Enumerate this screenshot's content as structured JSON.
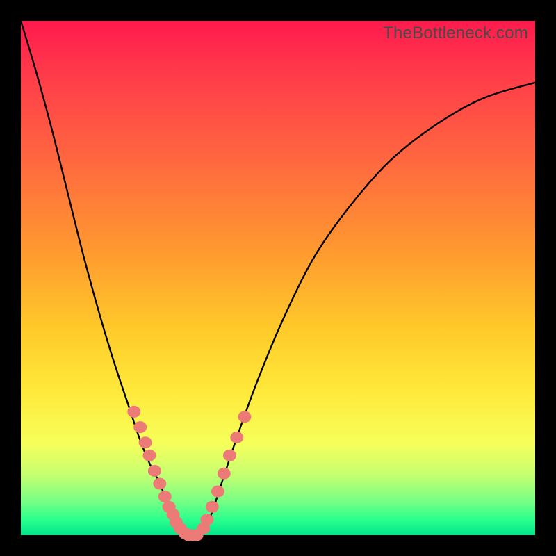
{
  "watermark": "TheBottleneck.com",
  "colors": {
    "frame": "#000000",
    "gradient_top": "#ff1a4d",
    "gradient_bottom": "#00e58a",
    "curve": "#000000",
    "bead": "#ec7b78"
  },
  "chart_data": {
    "type": "line",
    "title": "",
    "xlabel": "",
    "ylabel": "",
    "xlim": [
      0,
      100
    ],
    "ylim": [
      0,
      100
    ],
    "grid": false,
    "legend": false,
    "annotations": [
      "TheBottleneck.com"
    ],
    "series": [
      {
        "name": "left-curve",
        "x": [
          0,
          3,
          6,
          9,
          12,
          15,
          18,
          21,
          23,
          25,
          27,
          29,
          30,
          31,
          32
        ],
        "y": [
          100,
          90,
          79,
          67,
          55,
          44,
          34,
          25,
          19,
          14,
          10,
          5,
          2,
          1,
          0
        ]
      },
      {
        "name": "right-curve",
        "x": [
          35,
          37,
          39,
          42,
          46,
          51,
          57,
          64,
          72,
          81,
          90,
          100
        ],
        "y": [
          0,
          4,
          10,
          19,
          30,
          42,
          54,
          64,
          73,
          80,
          85,
          88
        ]
      },
      {
        "name": "beads-left",
        "note": "salmon markers on lower portion of left curve",
        "x": [
          22.0,
          23.2,
          24.2,
          25.0,
          26.0,
          27.0,
          28.0,
          28.8,
          29.6,
          30.2,
          31.0,
          32.0
        ],
        "y": [
          24.0,
          21.0,
          18.0,
          15.5,
          12.5,
          10.0,
          7.5,
          5.5,
          4.0,
          2.5,
          1.3,
          0.3
        ]
      },
      {
        "name": "beads-bottom",
        "note": "bridge of beads at trough",
        "x": [
          32.6,
          33.4,
          34.2
        ],
        "y": [
          0.0,
          0.0,
          0.0
        ]
      },
      {
        "name": "beads-right",
        "note": "salmon markers on lower portion of right curve",
        "x": [
          35.5,
          36.2,
          37.2,
          38.3,
          39.5,
          40.6,
          42.0,
          43.5
        ],
        "y": [
          1.3,
          3.0,
          5.5,
          8.5,
          12.0,
          15.5,
          19.0,
          23.0
        ]
      }
    ]
  }
}
